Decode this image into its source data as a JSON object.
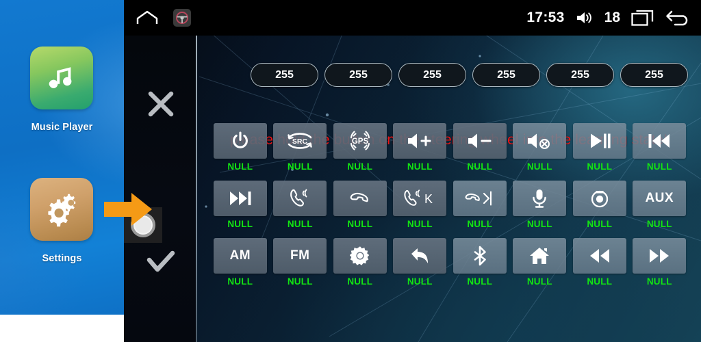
{
  "sidebar": {
    "apps": [
      {
        "label": "Music Player",
        "icon": "music-note-icon"
      },
      {
        "label": "Settings",
        "icon": "gears-icon"
      }
    ],
    "pointer": {
      "icon": "orange-arrow-right-icon"
    },
    "touch_indicator": {
      "icon": "touch-circle-icon"
    }
  },
  "statusbar": {
    "home_icon": "home-outline-icon",
    "steering_wheel_icon": "steering-wheel-icon",
    "clock": "17:53",
    "volume_icon": "volume-speaker-icon",
    "volume_value": "18",
    "recents_icon": "recent-apps-icon",
    "back_icon": "back-arrow-icon"
  },
  "panel": {
    "cancel_icon": "close-x-icon",
    "confirm_icon": "check-icon"
  },
  "chips": {
    "values": [
      "255",
      "255",
      "255",
      "255",
      "255",
      "255"
    ]
  },
  "warning": {
    "text": "please hold the button on the steering wheel into the learning state!",
    "color": "#f01414"
  },
  "grid": {
    "null_label": "NULL",
    "label_color": "#12e512",
    "rows": [
      [
        {
          "icon": "power-icon",
          "text": "",
          "label": "NULL"
        },
        {
          "icon": "src-icon",
          "text": "SRC",
          "label": "NULL"
        },
        {
          "icon": "gps-icon",
          "text": "GPS",
          "label": "NULL"
        },
        {
          "icon": "volume-up-icon",
          "text": "",
          "label": "NULL"
        },
        {
          "icon": "volume-down-icon",
          "text": "",
          "label": "NULL"
        },
        {
          "icon": "volume-mute-icon",
          "text": "",
          "label": "NULL"
        },
        {
          "icon": "play-pause-icon",
          "text": "",
          "label": "NULL"
        },
        {
          "icon": "previous-track-icon",
          "text": "",
          "label": "NULL"
        }
      ],
      [
        {
          "icon": "next-track-icon",
          "text": "",
          "label": "NULL"
        },
        {
          "icon": "phone-answer-icon",
          "text": "",
          "label": "NULL"
        },
        {
          "icon": "phone-hangup-icon",
          "text": "",
          "label": "NULL"
        },
        {
          "icon": "phone-answer-k-icon",
          "text": "K",
          "label": "NULL"
        },
        {
          "icon": "phone-hangup-next-icon",
          "text": "",
          "label": "NULL"
        },
        {
          "icon": "microphone-icon",
          "text": "",
          "label": "NULL"
        },
        {
          "icon": "camera-icon",
          "text": "",
          "label": "NULL"
        },
        {
          "icon": "aux-icon",
          "text": "AUX",
          "label": "NULL"
        }
      ],
      [
        {
          "icon": "am-icon",
          "text": "AM",
          "label": "NULL"
        },
        {
          "icon": "fm-icon",
          "text": "FM",
          "label": "NULL"
        },
        {
          "icon": "brightness-gear-icon",
          "text": "",
          "label": "NULL"
        },
        {
          "icon": "back-curve-icon",
          "text": "",
          "label": "NULL"
        },
        {
          "icon": "bluetooth-icon",
          "text": "",
          "label": "NULL"
        },
        {
          "icon": "home-filled-icon",
          "text": "",
          "label": "NULL"
        },
        {
          "icon": "rewind-icon",
          "text": "",
          "label": "NULL"
        },
        {
          "icon": "fast-forward-icon",
          "text": "",
          "label": "NULL"
        }
      ]
    ]
  },
  "colors": {
    "accent_orange": "#f59a16",
    "sidebar_blue": "#0e6fc4",
    "green_label": "#12e512",
    "warning_red": "#f01414"
  }
}
